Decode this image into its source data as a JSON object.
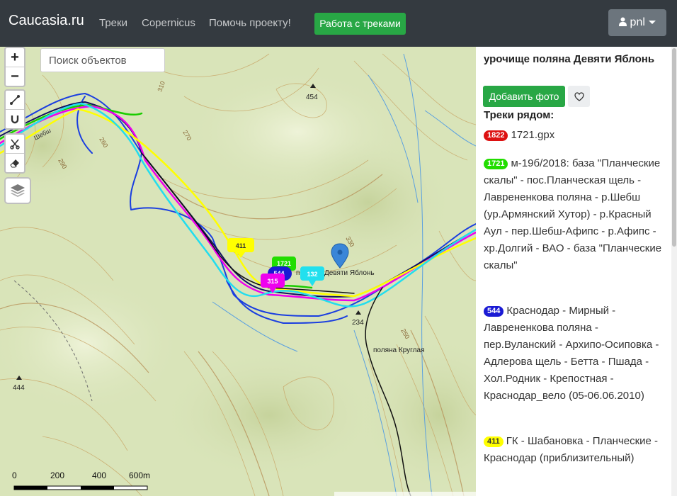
{
  "navbar": {
    "brand": "Caucasia.ru",
    "links": [
      "Треки",
      "Copernicus",
      "Помочь проекту!"
    ],
    "work_button": "Работа с треками",
    "user": "pnl"
  },
  "map": {
    "search_placeholder": "Поиск объектов",
    "zoom_in": "+",
    "zoom_out": "−",
    "place_labels": {
      "devyati": "Девяти Яблонь",
      "devyati_prefix": "п",
      "kruglaya": "поляна Круглая",
      "sheb": "Шебш"
    },
    "elevations": {
      "e454": "454",
      "e234": "234",
      "e444": "444"
    },
    "contours": {
      "c310": "310",
      "c270": "270",
      "c330": "330",
      "c290": "290",
      "c260": "260",
      "c250": "250"
    },
    "markers": [
      {
        "label": "411",
        "color": "#ffff00",
        "text_color": "#333333"
      },
      {
        "label": "1721",
        "color": "#22dd00",
        "text_color": "#ffffff"
      },
      {
        "label": "544",
        "color": "#1a1ad4",
        "text_color": "#ffffff"
      },
      {
        "label": "315",
        "color": "#ee00ee",
        "text_color": "#ffffff"
      },
      {
        "label": "132",
        "color": "#22e0ee",
        "text_color": "#ffffff"
      }
    ],
    "scale": {
      "s0": "0",
      "s200": "200",
      "s400": "400",
      "s600": "600m"
    }
  },
  "panel": {
    "place_title": "урочище поляна Девяти Яблонь",
    "add_photo": "Добавить фото",
    "nearby_title": "Треки рядом:",
    "tracks": [
      {
        "badge": "1822",
        "color": "#dd1111",
        "text_color": "#ffffff",
        "title": "1721.gpx"
      },
      {
        "badge": "1721",
        "color": "#22dd00",
        "text_color": "#ffffff",
        "title": "м-19б/2018: база \"Планческие скалы\" - пос.Планческая щель - Лаврененкова поляна - р.Шебш (ур.Армянский Хутор) - р.Красный Аул - пер.Шебш-Афипс - р.Афипс - хр.Долгий - ВАО - база \"Планческие скалы\""
      },
      {
        "badge": "544",
        "color": "#1a1ad4",
        "text_color": "#ffffff",
        "title": "Краснодар - Мирный - Лаврененкова поляна - пер.Вуланский - Архипо-Осиповка - Адлерова щель - Бетта - Пшада - Хол.Родник - Крепостная - Краснодар_вело (05-06.06.2010)"
      },
      {
        "badge": "411",
        "color": "#ffff00",
        "text_color": "#333333",
        "title": "ГК - Шабановка - Планческие - Краснодар (приблизительный)"
      }
    ]
  }
}
